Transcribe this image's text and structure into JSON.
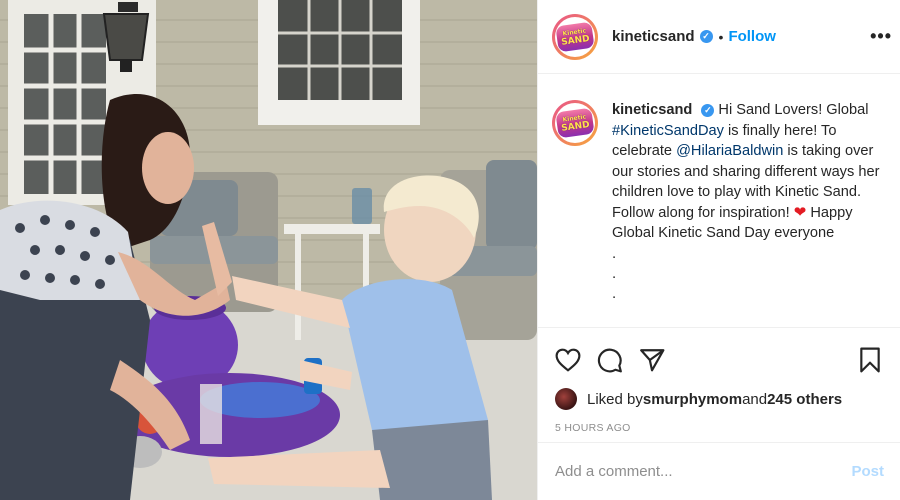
{
  "post": {
    "username": "kineticsand",
    "verified": true,
    "follow_label": "Follow",
    "separator": "•",
    "more_label": "•••",
    "avatar_logo": {
      "line1": "Kinetic",
      "line2": "SAND"
    },
    "caption": {
      "username": "kineticsand",
      "text_1": "Hi Sand Lovers! Global ",
      "hashtag": "#KineticSandDay",
      "text_2": " is finally here! To celebrate ",
      "mention": "@HilariaBaldwin",
      "text_3": " is taking over our stories and sharing different ways her children love to play with Kinetic Sand. Follow along for inspiration! ",
      "emoji": "❤",
      "text_4": " Happy Global Kinetic Sand Day everyone",
      "dots": [
        ".",
        ".",
        "."
      ]
    },
    "likes": {
      "prefix": "Liked by ",
      "liker": "smurphymom",
      "middle": " and ",
      "others": "245 others"
    },
    "timestamp": "5 HOURS AGO",
    "comment": {
      "placeholder": "Add a comment...",
      "post_label": "Post"
    }
  },
  "icons": [
    "heart-icon",
    "comment-icon",
    "share-icon",
    "bookmark-icon",
    "verified-badge-icon",
    "more-options-icon"
  ],
  "colors": {
    "link_blue": "#0095f6",
    "hashtag_blue": "#00376b",
    "verified_blue": "#3897f0",
    "muted_text": "#8e8e8e",
    "post_disabled": "#b3dbff",
    "divider": "#efefef"
  }
}
